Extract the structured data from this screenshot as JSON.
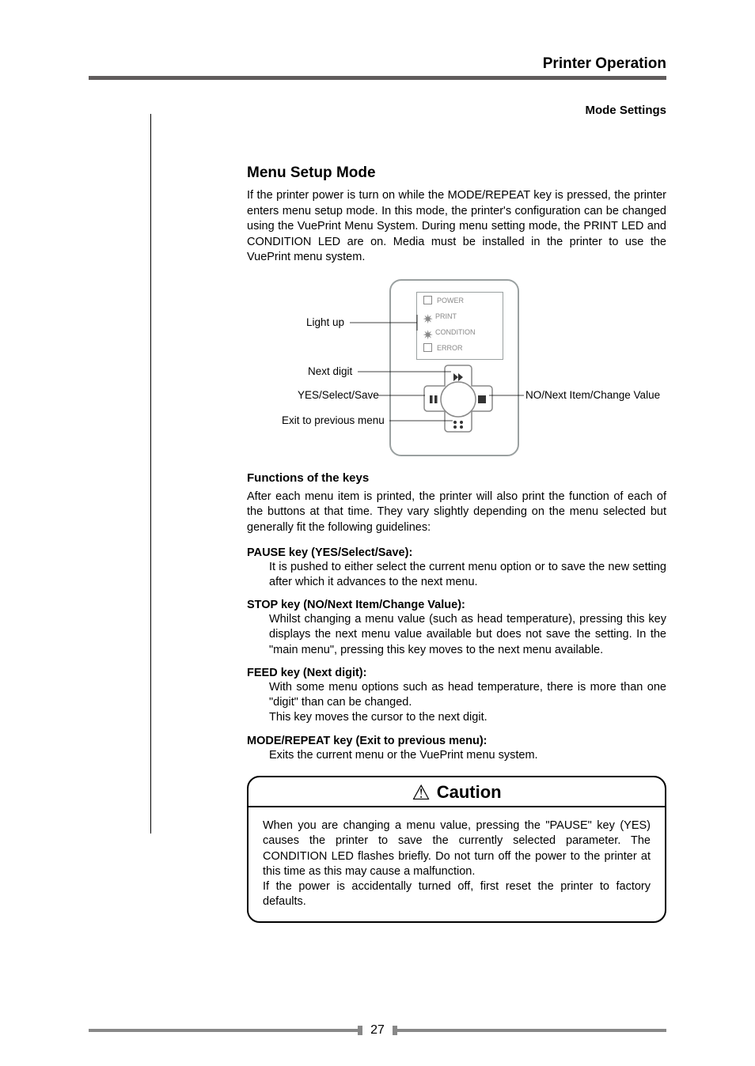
{
  "header": {
    "chapter": "Printer Operation",
    "section": "Mode Settings"
  },
  "h2": "Menu Setup Mode",
  "intro": "If the printer power is turn on while the MODE/REPEAT key is pressed, the printer enters menu setup mode. In this mode, the printer's configuration can be changed using the VuePrint Menu System.  During menu setting mode, the PRINT LED and CONDITION LED are on.  Media must be installed in the printer to use the VuePrint menu system.",
  "diagram": {
    "leds": {
      "power": "POWER",
      "print": "PRINT",
      "condition": "CONDITION",
      "error": "ERROR"
    },
    "labels": {
      "light_up": "Light up",
      "next_digit": "Next digit",
      "yes": "YES/Select/Save",
      "exit": "Exit to previous menu",
      "no": "NO/Next Item/Change Value"
    }
  },
  "keys_h": "Functions of the keys",
  "keys_intro": "After each menu item is printed, the printer will also print the function of each of the buttons at that time.  They vary slightly depending on the menu selected but generally fit the following  guidelines:",
  "keys": {
    "pause_h": "PAUSE key (YES/Select/Save)",
    "pause_b": "It is pushed to either select the current menu option or to save the new setting after which it advances to the next menu.",
    "stop_h": "STOP key (NO/Next Item/Change Value)",
    "stop_b": "Whilst changing a menu value (such as head temperature), pressing this key displays the next menu value available but does not save the setting. In the \"main menu\", pressing this key moves to the next menu available.",
    "feed_h": "FEED key (Next digit)",
    "feed_b1": "With some menu options such as head temperature, there is more than one \"digit\" than can be changed.",
    "feed_b2": "This key moves the  cursor to the next digit.",
    "mode_h": "MODE/REPEAT key (Exit to previous menu)",
    "mode_b": "Exits the current menu or the VuePrint menu system."
  },
  "caution": {
    "title": "Caution",
    "p1": "When you are changing a menu value, pressing the \"PAUSE\" key (YES) causes the printer to save the currently selected parameter. The CONDITION LED flashes briefly. Do not turn off the power to the printer at this time as this may cause a malfunction.",
    "p2": "If the power is accidentally turned off, first reset the printer to factory defaults."
  },
  "page_no": "27"
}
